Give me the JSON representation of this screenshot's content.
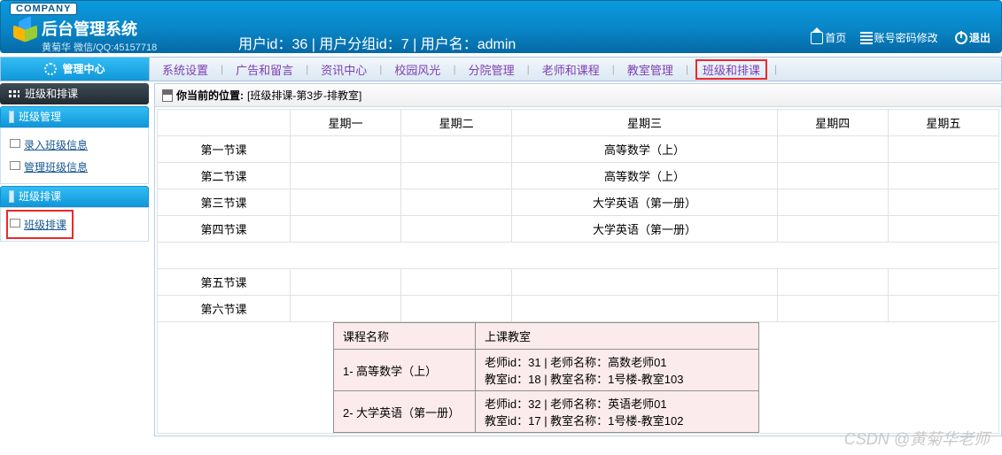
{
  "header": {
    "company_badge": "COMPANY",
    "title": "后台管理系统",
    "subtitle": "黄菊华  微信/QQ:45157718",
    "user_line": "用户id：36 | 用户分组id：7 | 用户名：admin",
    "home": "首页",
    "pwd": "账号密码修改",
    "logout": "退出"
  },
  "ribbon": {
    "left": "管理中心",
    "items": [
      "系统设置",
      "广告和留言",
      "资讯中心",
      "校园风光",
      "分院管理",
      "老师和课程",
      "教室管理",
      "班级和排课"
    ],
    "highlighted": 7
  },
  "sidebar": {
    "group0": {
      "title": "班级和排课"
    },
    "group1": {
      "title": "班级管理",
      "items": [
        "录入班级信息",
        "管理班级信息"
      ]
    },
    "group2": {
      "title": "班级排课",
      "items": [
        "班级排课"
      ]
    }
  },
  "crumb": {
    "label": "你当前的位置:",
    "path": "[班级排课-第3步-排教室]"
  },
  "timetable": {
    "days": [
      "星期一",
      "星期二",
      "星期三",
      "星期四",
      "星期五"
    ],
    "periods_a": [
      "第一节课",
      "第二节课",
      "第三节课",
      "第四节课"
    ],
    "periods_b": [
      "第五节课",
      "第六节课"
    ],
    "cells": {
      "r0c2": "高等数学（上）",
      "r1c2": "高等数学（上）",
      "r2c2": "大学英语（第一册）",
      "r3c2": "大学英语（第一册）"
    }
  },
  "info": {
    "h1": "课程名称",
    "h2": "上课教室",
    "rows": [
      {
        "name": "1- 高等数学（上）",
        "room": "老师id：31 | 老师名称：高数老师01\n教室id：18 | 教室名称：1号楼-教室103"
      },
      {
        "name": "2- 大学英语（第一册）",
        "room": "老师id：32 | 老师名称：英语老师01\n教室id：17 | 教室名称：1号楼-教室102"
      }
    ]
  },
  "watermark": "CSDN @黄菊华老师"
}
